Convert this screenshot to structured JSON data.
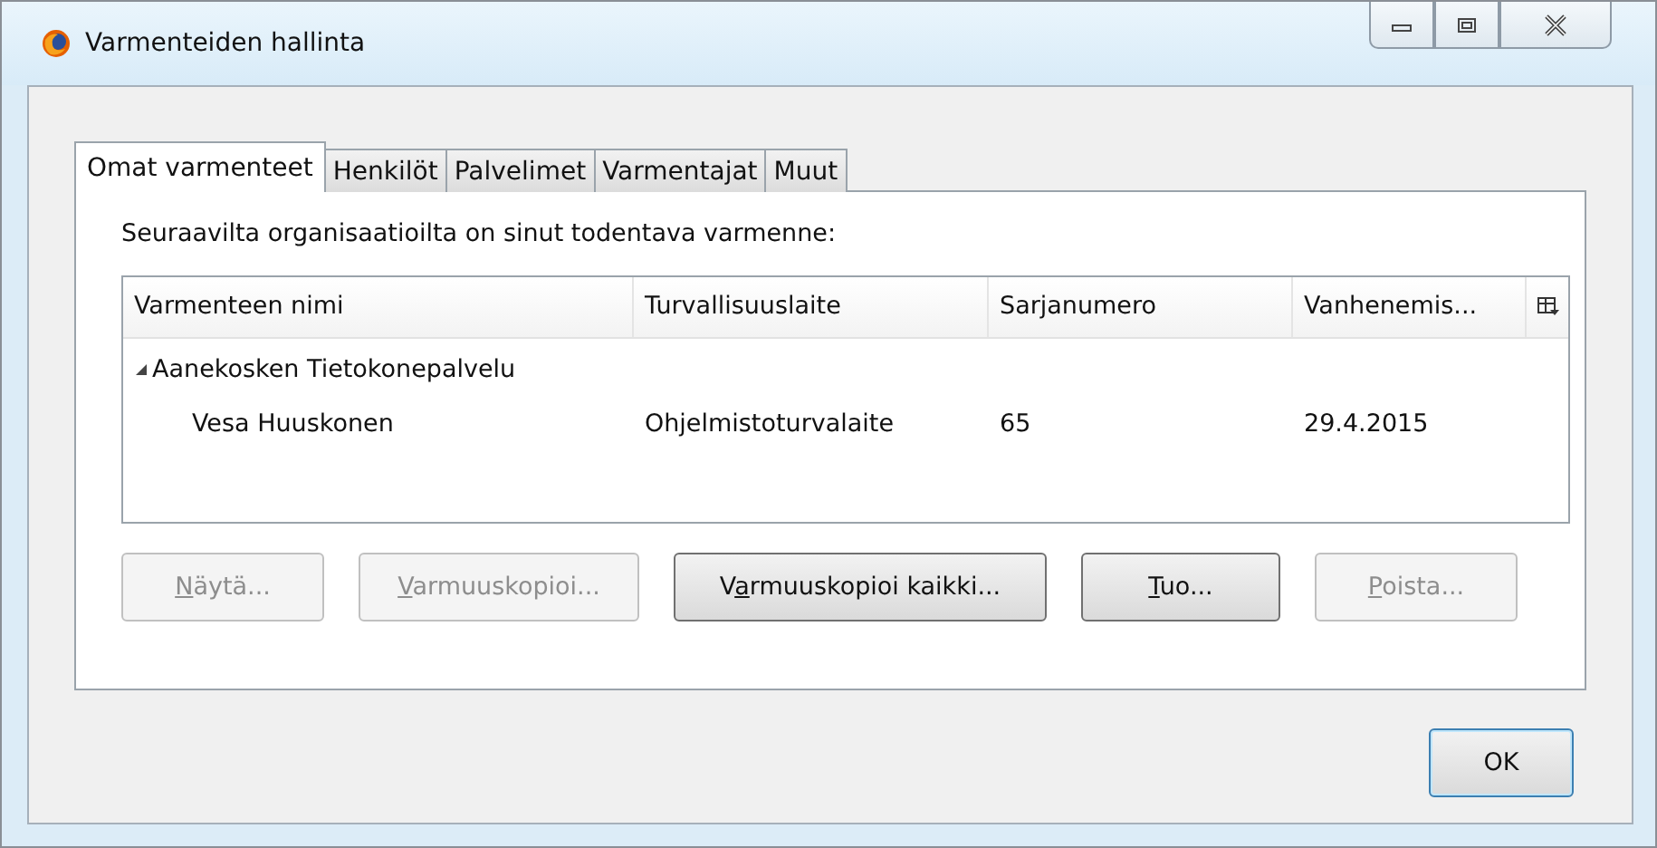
{
  "window": {
    "title": "Varmenteiden hallinta"
  },
  "tabs": [
    {
      "label": "Omat varmenteet",
      "selected": true
    },
    {
      "label": "Henkilöt",
      "selected": false
    },
    {
      "label": "Palvelimet",
      "selected": false
    },
    {
      "label": "Varmentajat",
      "selected": false
    },
    {
      "label": "Muut",
      "selected": false
    }
  ],
  "intro": "Seuraavilta organisaatioilta on sinut todentava varmenne:",
  "table": {
    "columns": [
      "Varmenteen nimi",
      "Turvallisuuslaite",
      "Sarjanumero",
      "Vanhenemis..."
    ],
    "groups": [
      {
        "name": "Aanekosken Tietokonepalvelu",
        "expanded": true,
        "rows": [
          {
            "cells": [
              "Vesa Huuskonen",
              "Ohjelmistoturvalaite",
              "65",
              "29.4.2015"
            ]
          }
        ]
      }
    ]
  },
  "buttons": [
    {
      "key": "N",
      "post": "äytä...",
      "disabled": true
    },
    {
      "key": "V",
      "post": "armuuskopioi...",
      "disabled": true
    },
    {
      "pre": "V",
      "key": "a",
      "post": "rmuuskopioi kaikki...",
      "disabled": false
    },
    {
      "key": "T",
      "post": "uo...",
      "disabled": false
    },
    {
      "key": "P",
      "post": "oista...",
      "disabled": true
    }
  ],
  "ok": "OK"
}
